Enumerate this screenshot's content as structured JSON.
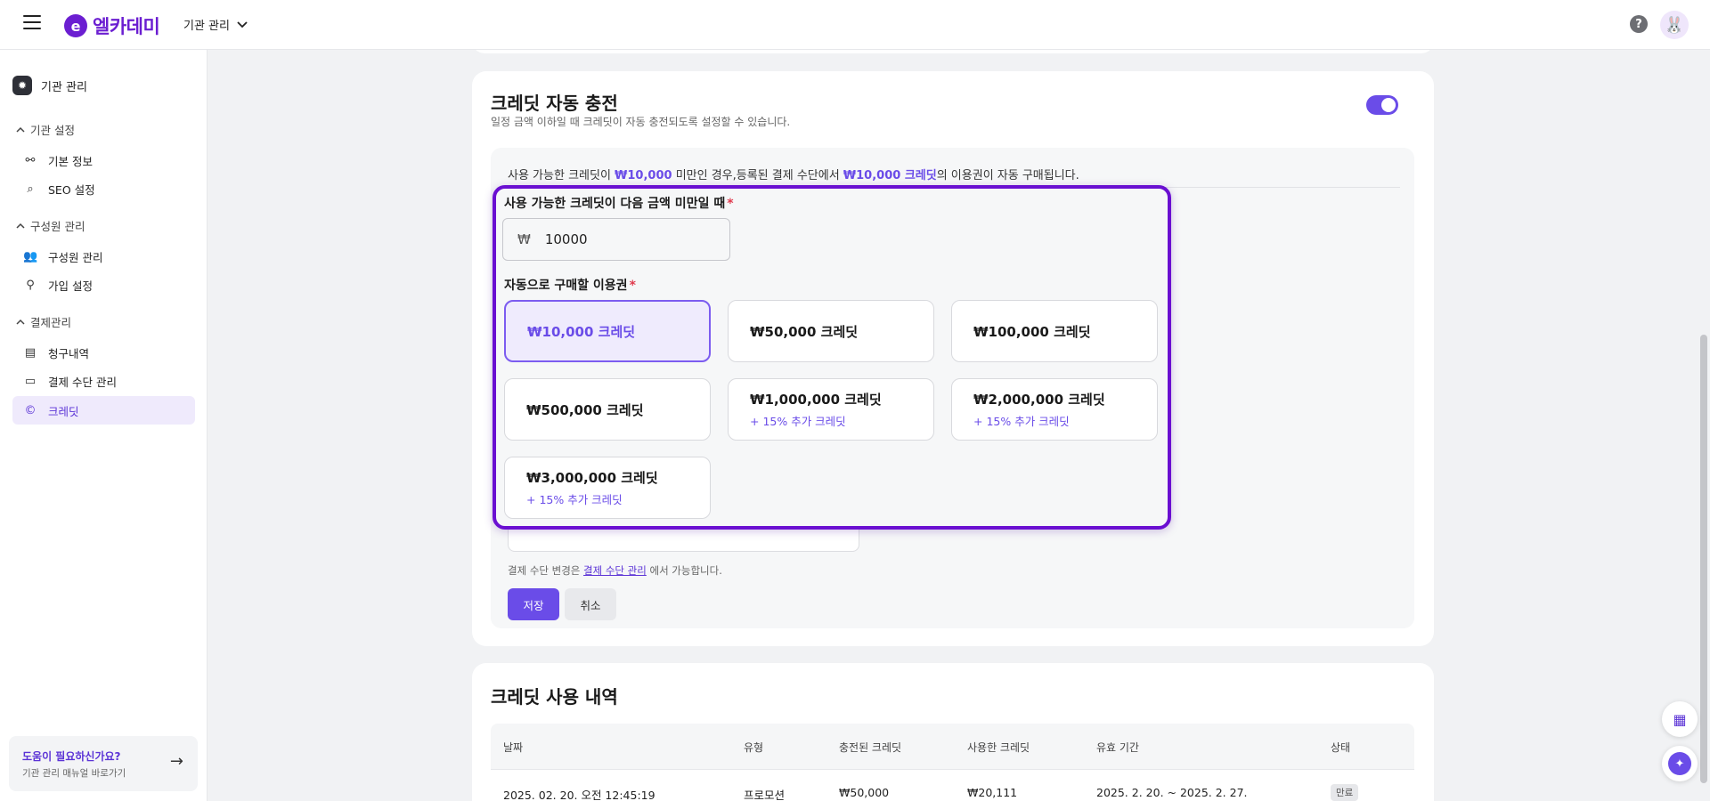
{
  "header": {
    "logo_mark": "e",
    "logo_text": "엘카데미",
    "org_selector": "기관 관리",
    "help": "?",
    "avatar_emoji": "🐰"
  },
  "sidebar": {
    "top": "기관 관리",
    "groups": [
      {
        "label": "기관 설정",
        "items": [
          "기본 정보",
          "SEO 설정"
        ]
      },
      {
        "label": "구성원 관리",
        "items": [
          "구성원 관리",
          "가입 설정"
        ]
      },
      {
        "label": "결제관리",
        "items": [
          "청구내역",
          "결제 수단 관리",
          "크레딧"
        ]
      }
    ],
    "active_item": "크레딧",
    "help_card": {
      "title": "도움이 필요하신가요?",
      "subtitle": "기관 관리 매뉴얼 바로가기"
    }
  },
  "auto_charge": {
    "title": "크레딧 자동 충전",
    "subtitle": "일정 금액 이하일 때 크레딧이 자동 충전되도록 설정할 수 있습니다.",
    "enabled": true,
    "notice": {
      "p1": "사용 가능한 크레딧이 ",
      "h1": "₩10,000",
      "p2": " 미만인 경우,등록된 결제 수단에서 ",
      "h2": "₩10,000 크레딧",
      "p3": "의 이용권이 자동 구매됩니다."
    },
    "threshold_label": "사용 가능한 크레딧이 다음 금액 미만일 때",
    "currency_symbol": "₩",
    "threshold_value": "10000",
    "plan_label": "자동으로 구매할 이용권",
    "required_mark": "*",
    "options": [
      {
        "label": "₩10,000 크레딧",
        "bonus": "",
        "selected": true
      },
      {
        "label": "₩50,000 크레딧",
        "bonus": "",
        "selected": false
      },
      {
        "label": "₩100,000 크레딧",
        "bonus": "",
        "selected": false
      },
      {
        "label": "₩500,000 크레딧",
        "bonus": "",
        "selected": false
      },
      {
        "label": "₩1,000,000 크레딧",
        "bonus": "+ 15% 추가 크레딧",
        "selected": false
      },
      {
        "label": "₩2,000,000 크레딧",
        "bonus": "+ 15% 추가 크레딧",
        "selected": false
      },
      {
        "label": "₩3,000,000 크레딧",
        "bonus": "+ 15% 추가 크레딧",
        "selected": false
      }
    ],
    "payment_note_prefix": "결제 수단 변경은 ",
    "payment_note_link": "결제 수단 관리",
    "payment_note_suffix": " 에서 가능합니다.",
    "save_label": "저장",
    "cancel_label": "취소"
  },
  "usage": {
    "title": "크레딧 사용 내역",
    "columns": [
      "날짜",
      "유형",
      "충전된 크레딧",
      "사용한 크레딧",
      "유효 기간",
      "상태"
    ],
    "rows": [
      {
        "date": "2025. 02. 20. 오전 12:45:19",
        "type": "프로모션",
        "charged": "₩50,000",
        "used": "₩20,111",
        "period": "2025. 2. 20. ~ 2025. 2. 27.",
        "status": "만료"
      }
    ]
  },
  "colors": {
    "accent": "#6a4ce8",
    "highlight_border": "#6a0fd1",
    "brand": "#6b1ed1"
  }
}
